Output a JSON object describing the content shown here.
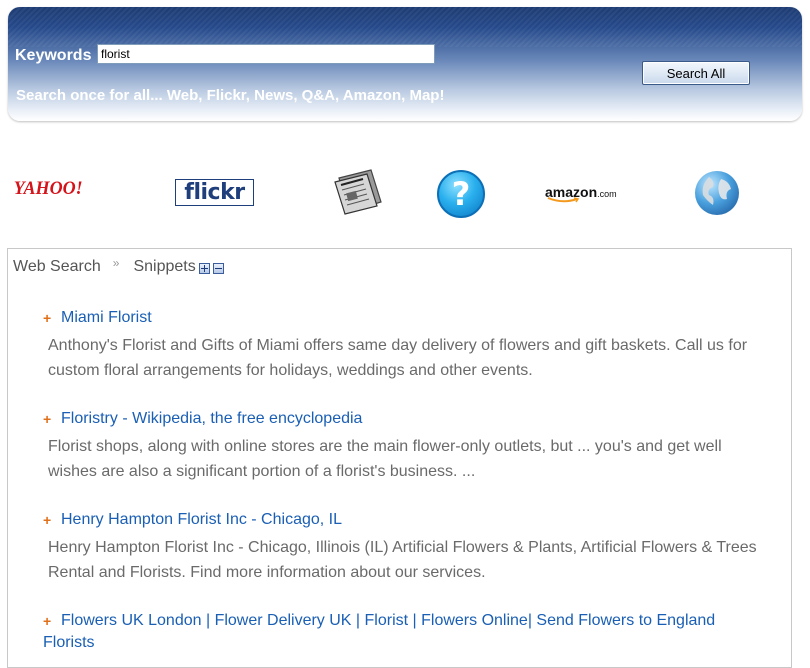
{
  "header": {
    "keywords_label": "Keywords",
    "query_value": "florist",
    "tagline": "Search once for all... Web, Flickr, News, Q&A, Amazon, Map!",
    "search_button_label": "Search All"
  },
  "sources": {
    "yahoo": "YAHOO!",
    "flickr": "flickr",
    "news_icon": "newspaper-icon",
    "qa_mark": "?",
    "amazon": "amazon",
    "amazon_domain": ".com",
    "map_icon": "globe-icon"
  },
  "breadcrumb": {
    "root": "Web Search",
    "separator": "»",
    "current": "Snippets"
  },
  "results": [
    {
      "title": "Miami Florist",
      "snippet": "Anthony's Florist and Gifts of Miami offers same day delivery of flowers and gift baskets. Call us for custom floral arrangements for holidays, weddings and other events."
    },
    {
      "title": "Floristry - Wikipedia, the free encyclopedia",
      "snippet": "Florist shops, along with online stores are the main flower-only outlets, but ... you's and get well wishes are also a significant portion of a florist's business. ..."
    },
    {
      "title": "Henry Hampton Florist Inc - Chicago, IL",
      "snippet": "Henry Hampton Florist Inc - Chicago, Illinois (IL) Artificial Flowers & Plants, Artificial Flowers & Trees Rental and Florists. Find more information about our services."
    },
    {
      "title": "Flowers UK London | Flower Delivery UK | Florist | Flowers Online| Send Flowers to England Florists",
      "snippet": ""
    }
  ],
  "colors": {
    "link": "#1a5fb4",
    "bullet": "#e0701a",
    "snippet": "#6a6a6a",
    "header_dark": "#1e3c73"
  }
}
